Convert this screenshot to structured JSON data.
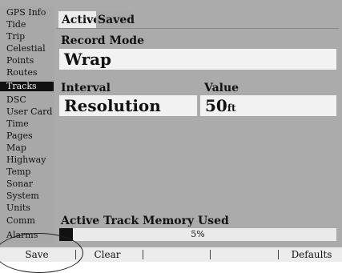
{
  "menu": {
    "items": [
      {
        "label": "GPS Info",
        "selected": false
      },
      {
        "label": "Tide",
        "selected": false
      },
      {
        "label": "Trip",
        "selected": false
      },
      {
        "label": "Celestial",
        "selected": false
      },
      {
        "label": "Points",
        "selected": false
      },
      {
        "label": "Routes",
        "selected": false
      },
      {
        "label": "Tracks",
        "selected": true
      },
      {
        "label": "DSC",
        "selected": false
      },
      {
        "label": "User Card",
        "selected": false
      },
      {
        "label": "Time",
        "selected": false
      },
      {
        "label": "Pages",
        "selected": false
      },
      {
        "label": "Map",
        "selected": false
      },
      {
        "label": "Highway",
        "selected": false
      },
      {
        "label": "Temp",
        "selected": false
      },
      {
        "label": "Sonar",
        "selected": false
      },
      {
        "label": "System",
        "selected": false
      },
      {
        "label": "Units",
        "selected": false
      },
      {
        "label": "Comm",
        "selected": false
      },
      {
        "label": "Alarms",
        "selected": false
      }
    ]
  },
  "tabs": {
    "active": "Active",
    "saved": "Saved"
  },
  "record_mode": {
    "label": "Record Mode",
    "value": "Wrap"
  },
  "interval": {
    "label": "Interval",
    "value": "Resolution"
  },
  "value_field": {
    "label": "Value",
    "value": "50",
    "unit": "ft"
  },
  "memory": {
    "label": "Active Track Memory Used",
    "percent_text": "5%",
    "fraction": 0.05
  },
  "softkeys": {
    "save": "Save",
    "clear": "Clear",
    "defaults": "Defaults"
  }
}
